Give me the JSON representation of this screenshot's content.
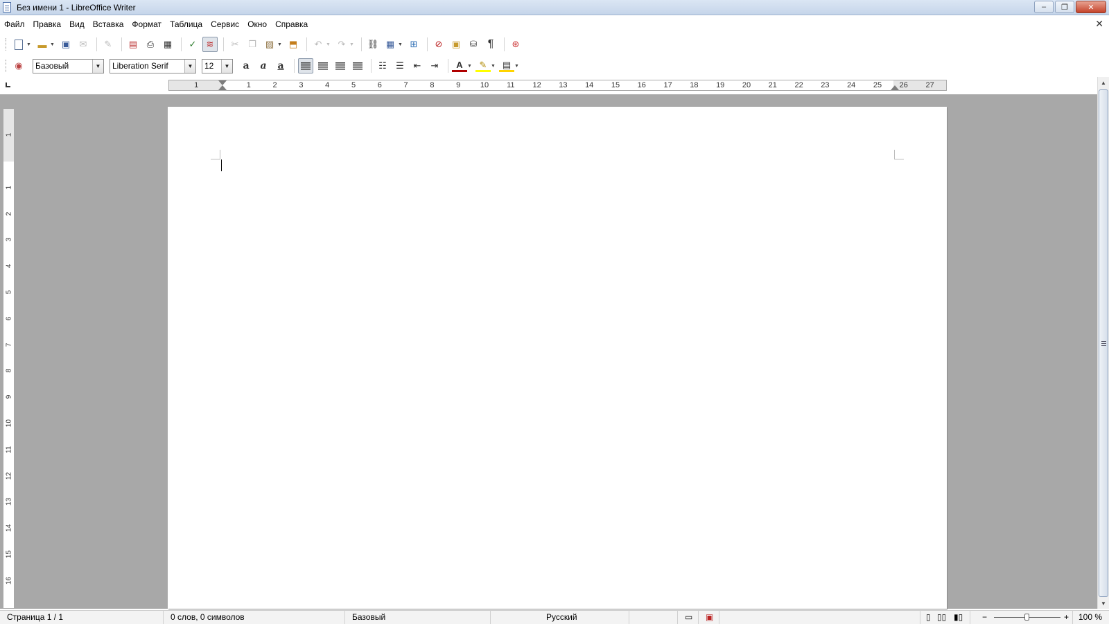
{
  "window": {
    "title": "Без имени 1 - LibreOffice Writer",
    "minimize_glyph": "–",
    "restore_glyph": "❐",
    "close_glyph": "✕"
  },
  "menu": {
    "items": [
      "Файл",
      "Правка",
      "Вид",
      "Вставка",
      "Формат",
      "Таблица",
      "Сервис",
      "Окно",
      "Справка"
    ],
    "close_glyph": "✕"
  },
  "toolbar_standard": {
    "icons": [
      "new-document-icon",
      "open-icon",
      "save-icon",
      "email-icon",
      "edit-mode-icon",
      "export-pdf-icon",
      "print-icon",
      "print-preview-icon",
      "spellcheck-icon",
      "autospellcheck-icon",
      "cut-icon",
      "copy-icon",
      "paste-icon",
      "clone-formatting-icon",
      "undo-icon",
      "redo-icon",
      "hyperlink-icon",
      "table-icon",
      "show-draw-functions-icon",
      "navigator-icon",
      "gallery-icon",
      "data-sources-icon",
      "formatting-marks-icon",
      "help-icon"
    ]
  },
  "toolbar_formatting": {
    "paragraph_style": "Базовый",
    "font_name": "Liberation Serif",
    "font_size": "12",
    "bold_glyph": "a",
    "italic_glyph": "a",
    "underline_glyph": "a",
    "pilcrow_glyph": "¶"
  },
  "ruler": {
    "horizontal_numbers": [
      "1",
      "1",
      "2",
      "3",
      "4",
      "5",
      "6",
      "7",
      "8",
      "9",
      "10",
      "11",
      "12",
      "13",
      "14",
      "15",
      "16",
      "17",
      "18",
      "19",
      "20",
      "21",
      "22",
      "23",
      "24",
      "25",
      "26",
      "27"
    ],
    "vertical_numbers": [
      "1",
      "1",
      "2",
      "3",
      "4",
      "5",
      "6",
      "7",
      "8",
      "9",
      "10",
      "11",
      "12",
      "13",
      "14",
      "15",
      "16",
      "17"
    ]
  },
  "statusbar": {
    "page": "Страница 1 / 1",
    "words": "0 слов, 0 символов",
    "page_style": "Базовый",
    "language": "Русский",
    "zoom": "100 %",
    "zoom_minus": "−",
    "zoom_plus": "+"
  },
  "colors": {
    "workspace_bg": "#a8a8a8",
    "titlebar_bg": "#c5d5ea",
    "close_button": "#c5432a"
  }
}
